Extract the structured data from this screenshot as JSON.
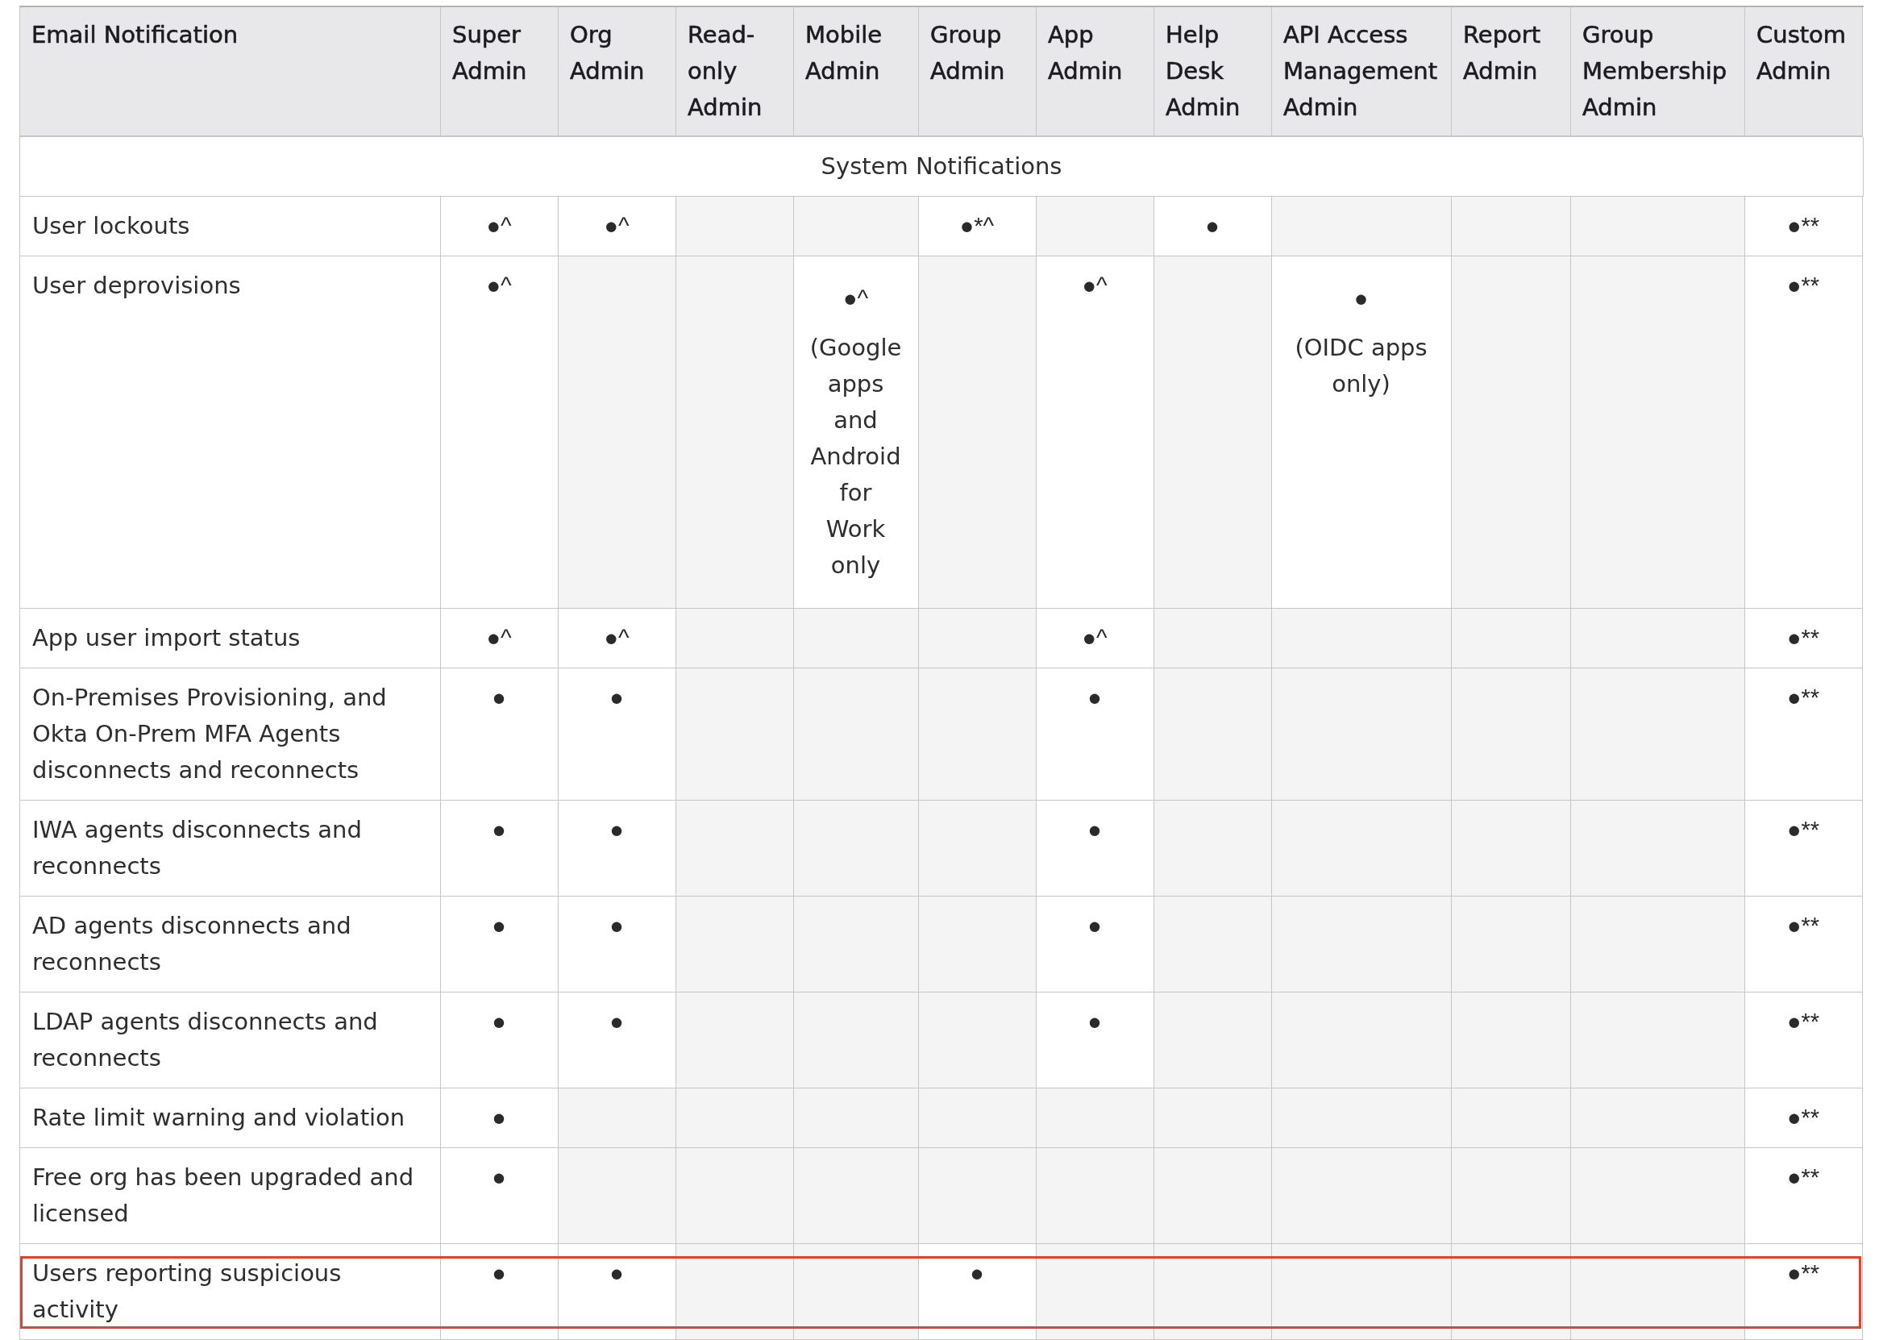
{
  "table": {
    "columns": [
      "Email Notification",
      "Super Admin",
      "Org Admin",
      "Read-only Admin",
      "Mobile Admin",
      "Group Admin",
      "App Admin",
      "Help Desk Admin",
      "API Access Management Admin",
      "Report Admin",
      "Group Membership Admin",
      "Custom Admin"
    ],
    "sections": [
      {
        "title": "System Notifications",
        "rows": [
          {
            "label": "User lockouts",
            "highlighted": false,
            "cells": [
              {
                "mark": "●^"
              },
              {
                "mark": "●^"
              },
              null,
              null,
              {
                "mark": "●*^"
              },
              null,
              {
                "mark": "●"
              },
              null,
              null,
              null,
              {
                "mark": "●**"
              }
            ]
          },
          {
            "label": "User deprovisions",
            "highlighted": false,
            "cells": [
              {
                "mark": "●^"
              },
              null,
              null,
              {
                "mark": "●^",
                "note": "(Google apps and Android for Work only"
              },
              null,
              {
                "mark": "●^"
              },
              null,
              {
                "mark": "●",
                "note": "(OIDC apps only)"
              },
              null,
              null,
              {
                "mark": "●**"
              }
            ]
          },
          {
            "label": "App user import status",
            "highlighted": false,
            "cells": [
              {
                "mark": "●^"
              },
              {
                "mark": "●^"
              },
              null,
              null,
              null,
              {
                "mark": "●^"
              },
              null,
              null,
              null,
              null,
              {
                "mark": "●**"
              }
            ]
          },
          {
            "label": "On-Premises Provisioning, and Okta On-Prem MFA Agents disconnects and reconnects",
            "highlighted": false,
            "cells": [
              {
                "mark": "●"
              },
              {
                "mark": "●"
              },
              null,
              null,
              null,
              {
                "mark": "●"
              },
              null,
              null,
              null,
              null,
              {
                "mark": "●**"
              }
            ]
          },
          {
            "label": "IWA agents disconnects and reconnects",
            "highlighted": false,
            "cells": [
              {
                "mark": "●"
              },
              {
                "mark": "●"
              },
              null,
              null,
              null,
              {
                "mark": "●"
              },
              null,
              null,
              null,
              null,
              {
                "mark": "●**"
              }
            ]
          },
          {
            "label": "AD agents disconnects and reconnects",
            "highlighted": false,
            "cells": [
              {
                "mark": "●"
              },
              {
                "mark": "●"
              },
              null,
              null,
              null,
              {
                "mark": "●"
              },
              null,
              null,
              null,
              null,
              {
                "mark": "●**"
              }
            ]
          },
          {
            "label": "LDAP agents disconnects and reconnects",
            "highlighted": false,
            "cells": [
              {
                "mark": "●"
              },
              {
                "mark": "●"
              },
              null,
              null,
              null,
              {
                "mark": "●"
              },
              null,
              null,
              null,
              null,
              {
                "mark": "●**"
              }
            ]
          },
          {
            "label": "Rate limit warning and violation",
            "highlighted": false,
            "cells": [
              {
                "mark": "●"
              },
              null,
              null,
              null,
              null,
              null,
              null,
              null,
              null,
              null,
              {
                "mark": "●**"
              }
            ]
          },
          {
            "label": "Free org has been upgraded and licensed",
            "highlighted": false,
            "cells": [
              {
                "mark": "●"
              },
              null,
              null,
              null,
              null,
              null,
              null,
              null,
              null,
              null,
              {
                "mark": "●**"
              }
            ]
          },
          {
            "label": "Users reporting suspicious activity",
            "highlighted": true,
            "cells": [
              {
                "mark": "●"
              },
              {
                "mark": "●"
              },
              null,
              null,
              {
                "mark": "●"
              },
              null,
              null,
              null,
              null,
              null,
              {
                "mark": "●**"
              }
            ]
          }
        ]
      }
    ]
  }
}
